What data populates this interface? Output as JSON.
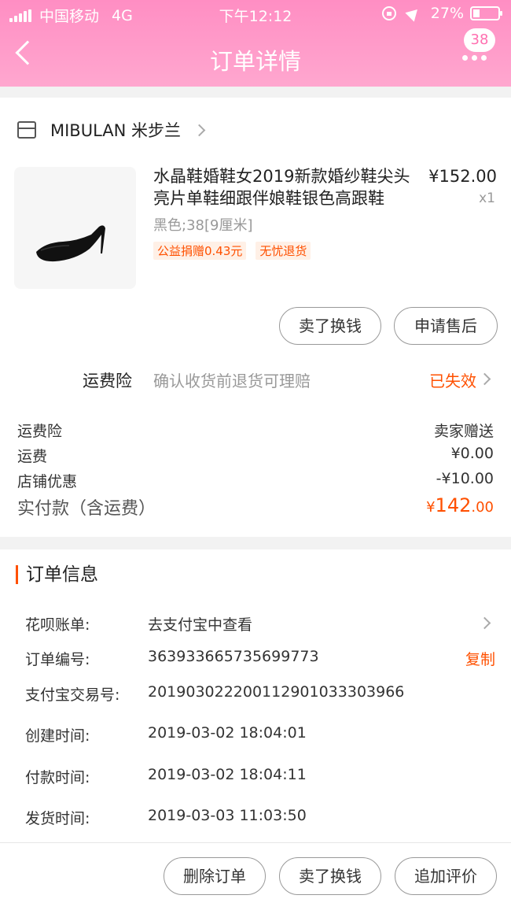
{
  "status_bar": {
    "carrier": "中国移动",
    "network": "4G",
    "time": "下午12:12",
    "battery": "27%"
  },
  "nav": {
    "title": "订单详情",
    "badge": "38"
  },
  "shop": {
    "name": "MIBULAN 米步兰"
  },
  "product": {
    "title": "水晶鞋婚鞋女2019新款婚纱鞋尖头亮片单鞋细跟伴娘鞋银色高跟鞋",
    "price": "¥152.00",
    "qty": "x1",
    "sku": "黑色;38[9厘米]",
    "tags": [
      "公益捐赠0.43元",
      "无忧退货"
    ]
  },
  "actions": {
    "sell": "卖了换钱",
    "aftersale": "申请售后"
  },
  "freight_insurance": {
    "label": "运费险",
    "desc": "确认收货前退货可理赔",
    "status": "已失效"
  },
  "fees": {
    "insurance_label": "运费险",
    "insurance_value": "卖家赠送",
    "shipping_label": "运费",
    "shipping_value": "¥0.00",
    "discount_label": "店铺优惠",
    "discount_value": "-¥10.00",
    "total_label": "实付款（含运费）",
    "total_symbol": "¥",
    "total_int": "142",
    "total_dec": ".00"
  },
  "order_info": {
    "title": "订单信息",
    "huabei_label": "花呗账单:",
    "huabei_value": "去支付宝中查看",
    "order_no_label": "订单编号:",
    "order_no_value": "363933665735699773",
    "copy_label": "复制",
    "alipay_label": "支付宝交易号:",
    "alipay_value": "2019030222001129010333039​66",
    "created_label": "创建时间:",
    "created_value": "2019-03-02 18:04:01",
    "paid_label": "付款时间:",
    "paid_value": "2019-03-02 18:04:11",
    "shipped_label": "发货时间:",
    "shipped_value": "2019-03-03 11:03:50"
  },
  "bottom_bar": {
    "delete": "删除订单",
    "sell": "卖了换钱",
    "review": "追加评价"
  },
  "colors": {
    "header": "#ff9cca",
    "accent": "#ff5000"
  }
}
